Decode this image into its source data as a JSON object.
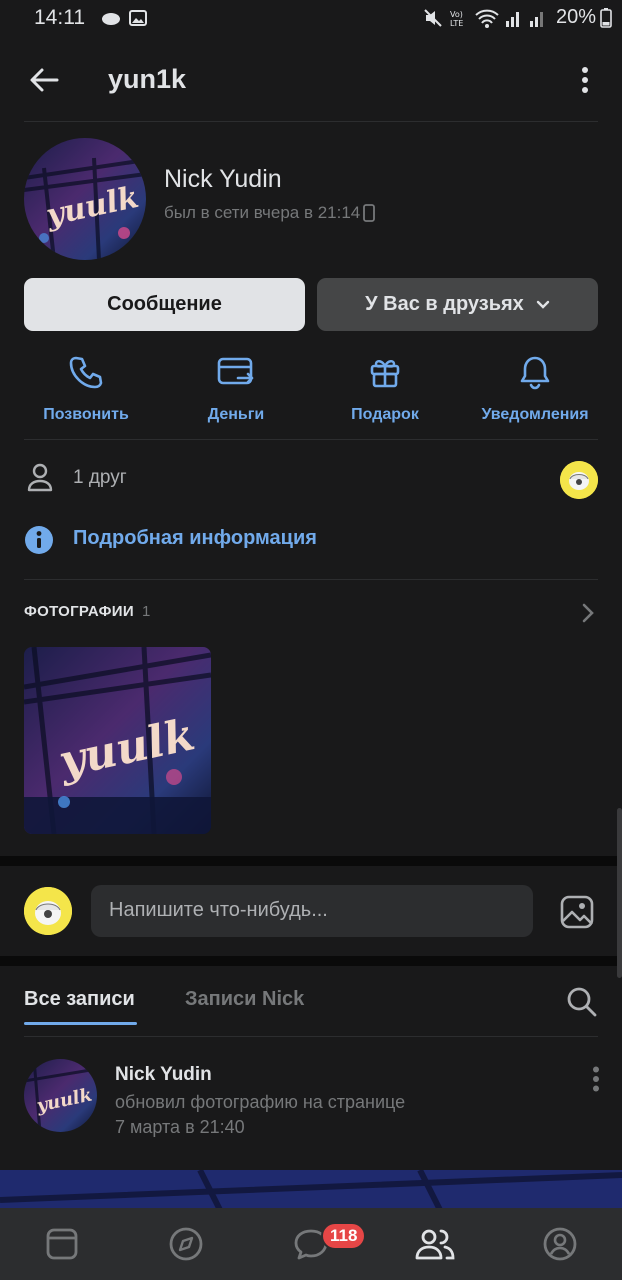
{
  "status_bar": {
    "time": "14:11",
    "battery": "20%"
  },
  "header": {
    "screen_name": "yun1k"
  },
  "profile": {
    "name": "Nick Yudin",
    "last_seen": "был в сети вчера в 21:14",
    "avatar_logo_text": "yuulk"
  },
  "buttons": {
    "message": "Сообщение",
    "friends": "У Вас в друзьях"
  },
  "actions": [
    {
      "label": "Позвонить",
      "icon": "phone-icon"
    },
    {
      "label": "Деньги",
      "icon": "money-transfer-icon"
    },
    {
      "label": "Подарок",
      "icon": "gift-icon"
    },
    {
      "label": "Уведомления",
      "icon": "bell-icon"
    }
  ],
  "friends_row": {
    "label": "1 друг"
  },
  "info_row": {
    "label": "Подробная информация"
  },
  "photos": {
    "title": "ФОТОГРАФИИ",
    "count": "1"
  },
  "composer": {
    "placeholder": "Напишите что-нибудь..."
  },
  "wall_tabs": {
    "all": "Все записи",
    "own": "Записи Nick"
  },
  "post": {
    "author": "Nick Yudin",
    "action": "обновил фотографию на странице",
    "date": "7 марта в 21:40"
  },
  "tab_bar": {
    "messages_badge": "118"
  },
  "colors": {
    "background": "#19191a",
    "accent": "#71aaeb",
    "badge": "#e64646",
    "secondary_button": "#454647"
  }
}
